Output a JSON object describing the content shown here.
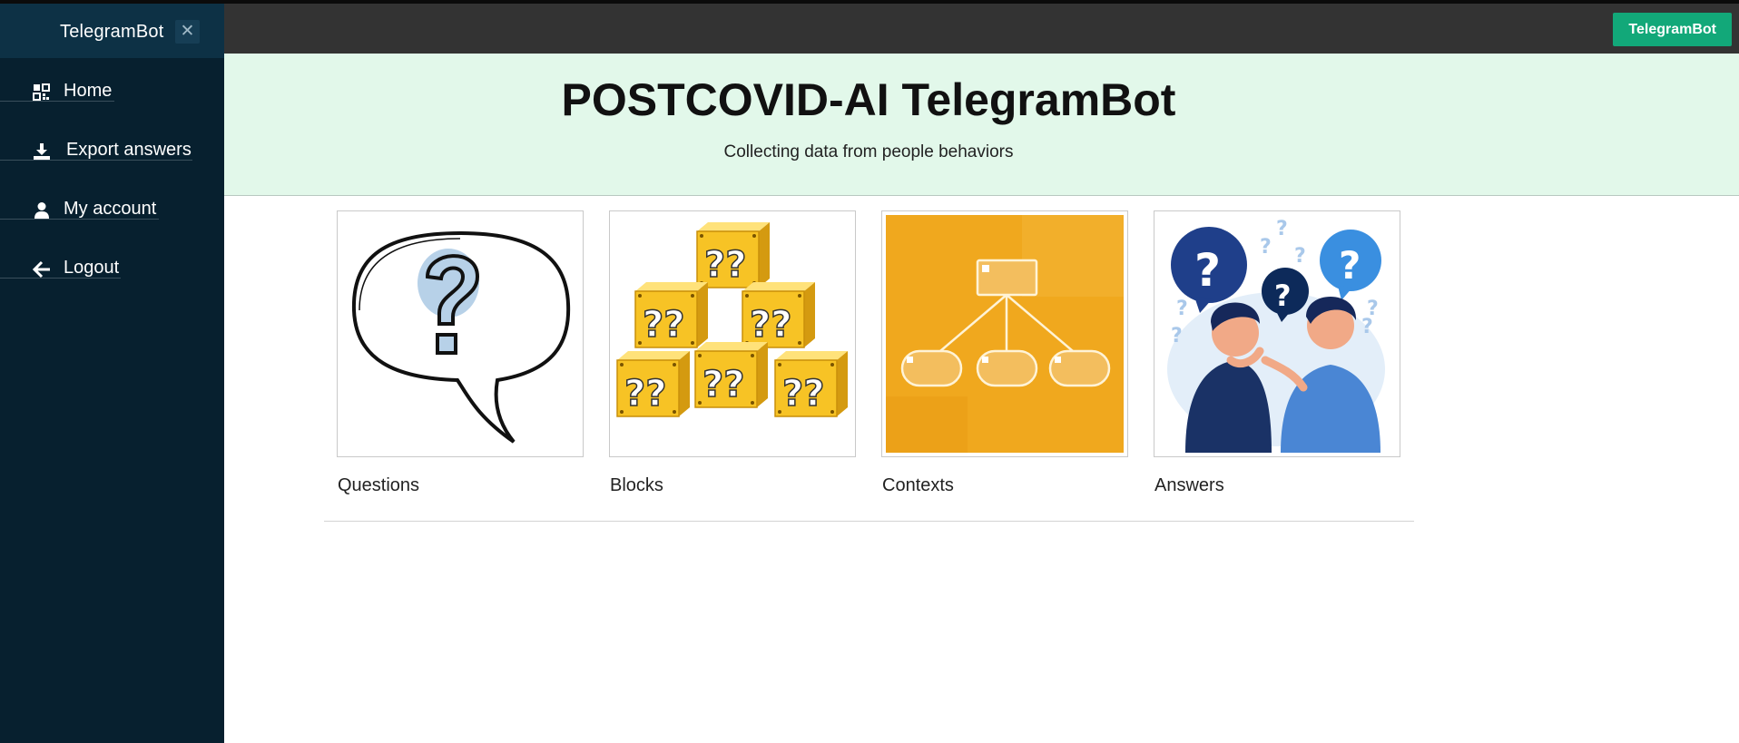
{
  "sidebar": {
    "brand": "TelegramBot",
    "close_symbol": "✕",
    "items": [
      {
        "label": "Home",
        "icon": "dashboard-grid-icon"
      },
      {
        "label": "Export answers",
        "icon": "download-icon"
      },
      {
        "label": "My account",
        "icon": "user-icon"
      },
      {
        "label": "Logout",
        "icon": "arrow-left-icon"
      }
    ]
  },
  "topbar": {
    "button_label": "TelegramBot"
  },
  "hero": {
    "title": "POSTCOVID-AI TelegramBot",
    "subtitle": "Collecting data from people behaviors"
  },
  "cards": [
    {
      "label": "Questions",
      "image": "speech-bubble-question-icon"
    },
    {
      "label": "Blocks",
      "image": "question-blocks-icon"
    },
    {
      "label": "Contexts",
      "image": "hierarchy-diagram-icon"
    },
    {
      "label": "Answers",
      "image": "people-thinking-icon"
    }
  ],
  "colors": {
    "sidebar_bg": "#07202f",
    "sidebar_header_bg": "#0d3145",
    "topbar_bg": "#333333",
    "accent": "#12a879",
    "hero_bg": "#e2f8ea",
    "contexts_bg": "#f0a81e"
  }
}
